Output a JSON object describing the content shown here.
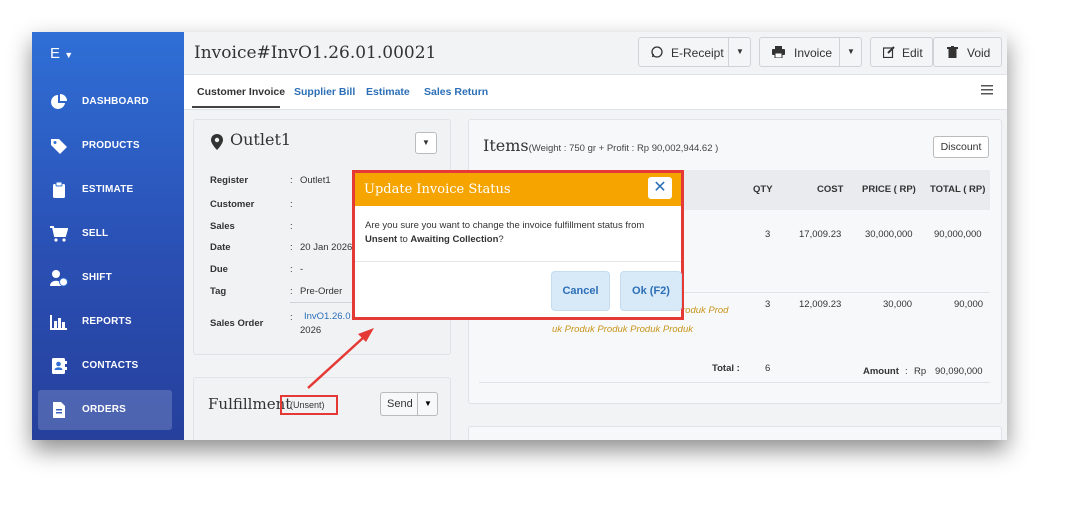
{
  "sidebar": {
    "brand": "E",
    "items": [
      {
        "label": "DASHBOARD",
        "icon": "pie-chart-icon"
      },
      {
        "label": "PRODUCTS",
        "icon": "tag-icon"
      },
      {
        "label": "ESTIMATE",
        "icon": "clipboard-icon"
      },
      {
        "label": "SELL",
        "icon": "cart-icon"
      },
      {
        "label": "SHIFT",
        "icon": "user-clock-icon"
      },
      {
        "label": "REPORTS",
        "icon": "bar-chart-icon"
      },
      {
        "label": "CONTACTS",
        "icon": "address-book-icon"
      },
      {
        "label": "ORDERS",
        "icon": "file-icon",
        "active": true
      }
    ]
  },
  "header": {
    "title": "Invoice#InvO1.26.01.00021",
    "buttons": {
      "ereceipt": "E-Receipt",
      "invoice": "Invoice",
      "edit": "Edit",
      "void": "Void"
    }
  },
  "tabs": [
    "Customer Invoice",
    "Supplier Bill",
    "Estimate",
    "Sales Return"
  ],
  "outlet": {
    "name": "Outlet1",
    "rows": [
      {
        "label": "Register",
        "value": "Outlet1"
      },
      {
        "label": "Customer",
        "value": ""
      },
      {
        "label": "Sales",
        "value": ""
      },
      {
        "label": "Date",
        "value": "20 Jan 2026"
      },
      {
        "label": "Due",
        "value": "-"
      },
      {
        "label": "Tag",
        "value": "Pre-Order"
      }
    ],
    "sales_order": {
      "label": "Sales Order",
      "link": "InvO1.26.0",
      "year": "2026"
    }
  },
  "fulfillment": {
    "title": "Fulfillment",
    "status": "(Unsent)",
    "send": "Send"
  },
  "items": {
    "title": "Items",
    "subtitle": "(Weight : 750 gr + Profit : Rp 90,002,944.62 )",
    "discount": "Discount",
    "columns": [
      "QTY",
      "COST",
      "PRICE ( RP)",
      "TOTAL ( RP)"
    ],
    "rows": [
      {
        "qty": "3",
        "cost": "17,009.23",
        "price": "30,000,000",
        "total": "90,000,000"
      },
      {
        "qty": "3",
        "cost": "12,009.23",
        "price": "30,000",
        "total": "90,000",
        "note1": "roduk Prod",
        "note2": "uk Produk Produk Produk Produk"
      }
    ],
    "total_label": "Total :",
    "total_qty": "6",
    "amount_label": "Amount",
    "amount_sep": ":",
    "currency": "Rp",
    "amount": "90,090,000"
  },
  "modal": {
    "title": "Update Invoice Status",
    "close": "✕",
    "msg_prefix": "Are you sure you want to change the invoice fulfillment status from ",
    "from": "Unsent",
    "msg_mid": " to ",
    "to": "Awaiting Collection",
    "msg_suffix": "?",
    "cancel": "Cancel",
    "ok": "Ok (F2)"
  },
  "colors": {
    "sidebar": "#2a4fb3",
    "modal_header": "#f5a400",
    "annotation": "#e53935",
    "link": "#2c6fb7"
  }
}
